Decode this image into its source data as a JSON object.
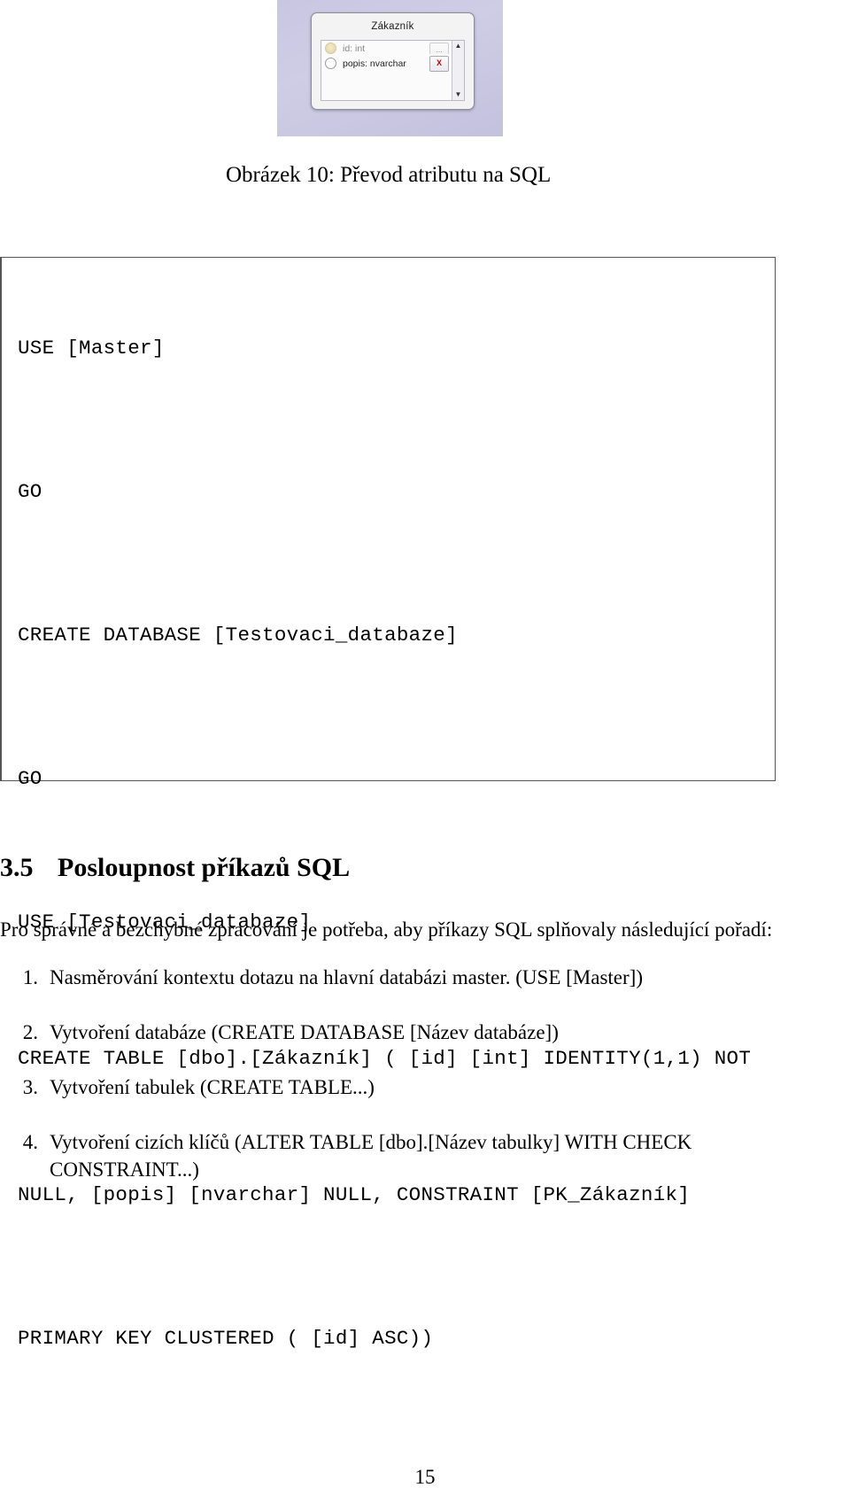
{
  "figure": {
    "dialog_title": "Zákazník",
    "rows": [
      {
        "label": "id: int",
        "button": "...",
        "kind": "key"
      },
      {
        "label": "popis: nvarchar",
        "button": "X",
        "kind": "plain"
      }
    ],
    "scroll_up": "▲",
    "scroll_down": "▼"
  },
  "caption": "Obrázek 10: Převod atributu na SQL",
  "code": {
    "lines": [
      "USE [Master]",
      "GO",
      "CREATE DATABASE [Testovaci_databaze]",
      "GO",
      "USE [Testovaci_databaze]",
      "CREATE TABLE [dbo].[Zákazník] ( [id] [int] IDENTITY(1,1) NOT",
      "NULL, [popis] [nvarchar] NULL, CONSTRAINT [PK_Zákazník]",
      "PRIMARY KEY CLUSTERED ( [id] ASC))"
    ]
  },
  "section": {
    "number": "3.5",
    "title": "Posloupnost příkazů SQL"
  },
  "paragraph": "Pro správné a bezchybné zpracování je potřeba, aby příkazy SQL splňovaly následující pořadí:",
  "steps": [
    {
      "number": "1.",
      "text": "Nasměrování kontextu dotazu na hlavní databázi master. (USE [Master])",
      "cont": ""
    },
    {
      "number": "2.",
      "text": "Vytvoření databáze (CREATE DATABASE [Název databáze])",
      "cont": ""
    },
    {
      "number": "3.",
      "text": "Vytvoření tabulek (CREATE TABLE...)",
      "cont": ""
    },
    {
      "number": "4.",
      "text": "Vytvoření cizích klíčů (ALTER TABLE [dbo].[Název tabulky] WITH CHECK",
      "cont": "CONSTRAINT...)"
    }
  ],
  "page_number": "15"
}
